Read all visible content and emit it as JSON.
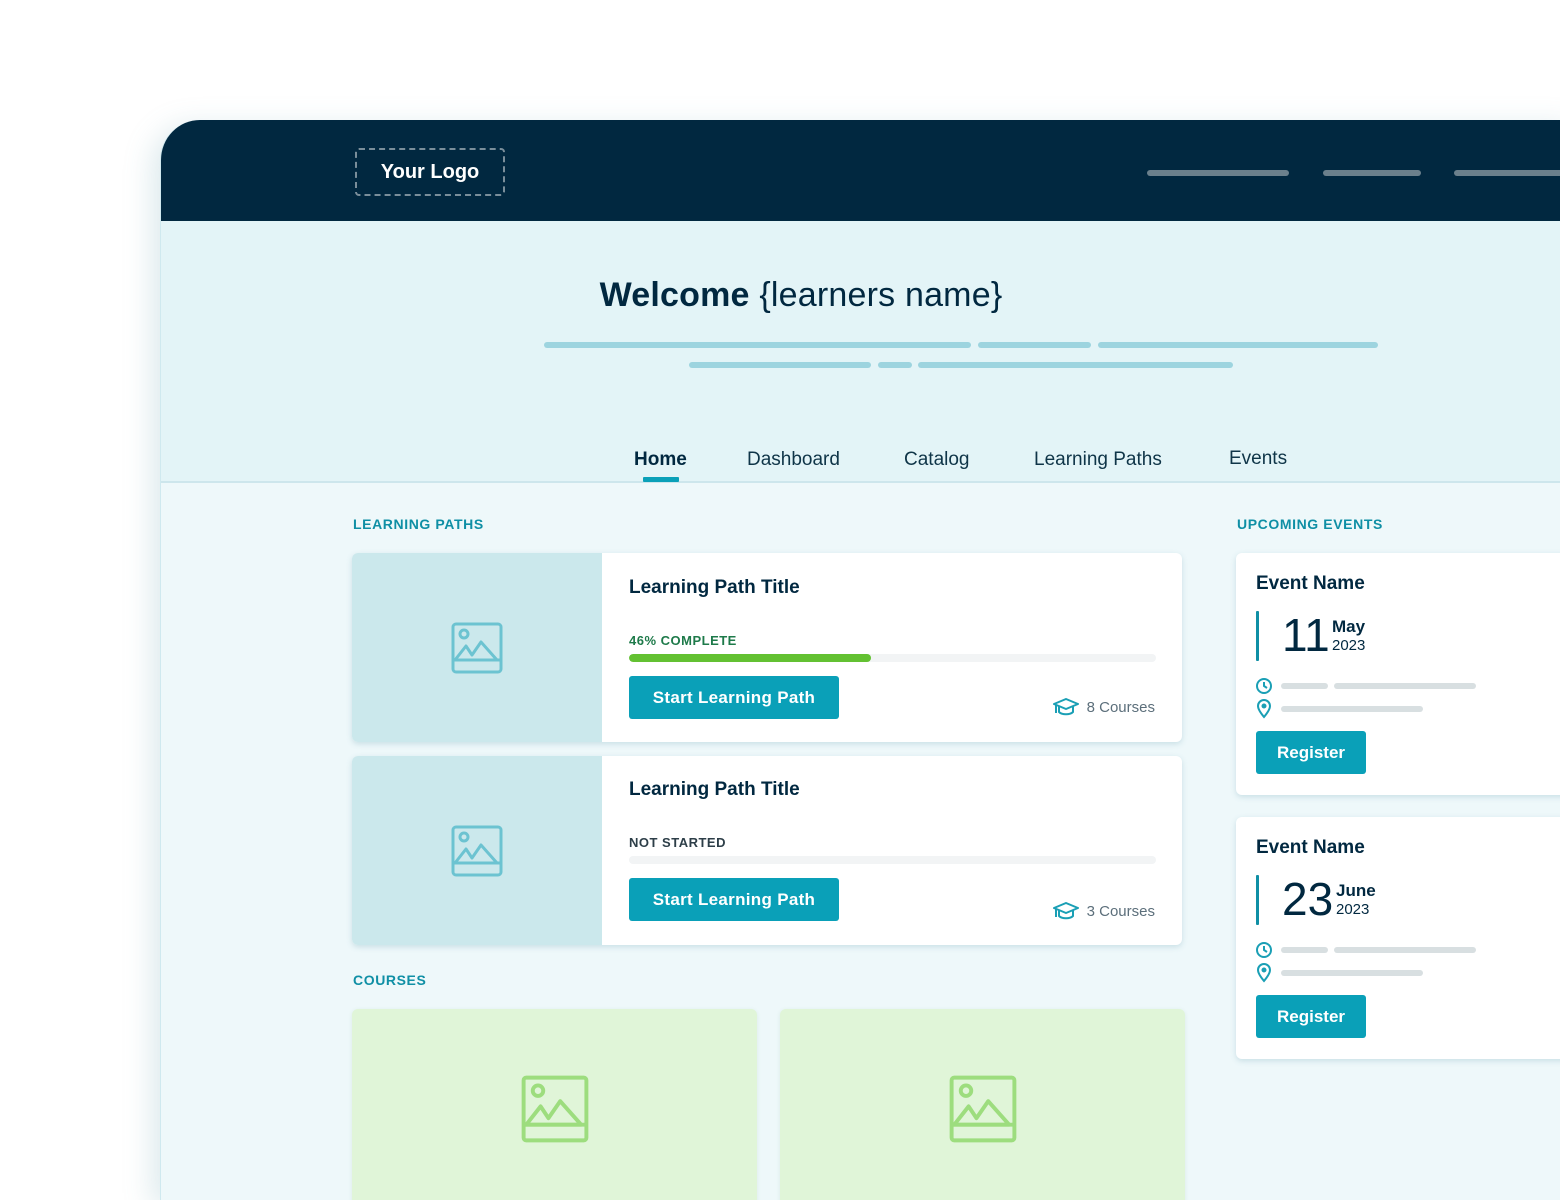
{
  "header": {
    "logo_text": "Your Logo",
    "nav_placeholders": [
      "nav-link-1",
      "nav-link-2",
      "nav-link-3"
    ]
  },
  "hero": {
    "welcome_bold": "Welcome",
    "welcome_name": "{learners name}"
  },
  "tabs": [
    {
      "label": "Home",
      "active": true
    },
    {
      "label": "Dashboard",
      "active": false
    },
    {
      "label": "Catalog",
      "active": false
    },
    {
      "label": "Learning Paths",
      "active": false
    },
    {
      "label": "Events",
      "active": false
    }
  ],
  "learning_paths": {
    "section_label": "LEARNING PATHS",
    "items": [
      {
        "title": "Learning Path Title",
        "status": "46% COMPLETE",
        "status_color": "#1e7a4a",
        "progress_percent": 46,
        "button_label": "Start Learning Path",
        "courses": "8 Courses"
      },
      {
        "title": "Learning Path Title",
        "status": "NOT STARTED",
        "status_color": "#2d3e48",
        "progress_percent": 0,
        "button_label": "Start Learning Path",
        "courses": "3 Courses"
      }
    ]
  },
  "courses": {
    "section_label": "COURSES",
    "items": [
      {
        "image": "image-placeholder"
      },
      {
        "image": "image-placeholder"
      }
    ]
  },
  "events": {
    "section_label": "UPCOMING EVENTS",
    "items": [
      {
        "name": "Event Name",
        "day": "11",
        "month": "May",
        "year": "2023",
        "button_label": "Register"
      },
      {
        "name": "Event Name",
        "day": "23",
        "month": "June",
        "year": "2023",
        "button_label": "Register"
      }
    ]
  },
  "colors": {
    "brand_dark": "#012840",
    "accent": "#0aa0b8",
    "progress_green": "#63c132",
    "hero_bg": "#e3f4f7",
    "course_bg": "#e0f5d8"
  }
}
